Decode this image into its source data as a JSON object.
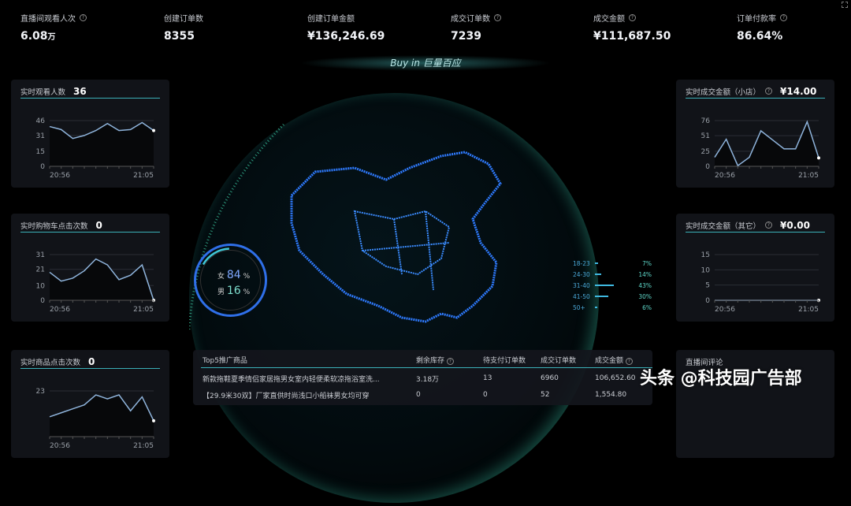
{
  "kpis": [
    {
      "label": "直播间观看人次",
      "help": true,
      "value": "6.08",
      "unit": "万"
    },
    {
      "label": "创建订单数",
      "help": false,
      "value": "8355",
      "unit": ""
    },
    {
      "label": "创建订单金额",
      "help": false,
      "value": "¥136,246.69",
      "unit": ""
    },
    {
      "label": "成交订单数",
      "help": true,
      "value": "7239",
      "unit": ""
    },
    {
      "label": "成交金额",
      "help": true,
      "value": "¥111,687.50",
      "unit": ""
    },
    {
      "label": "订单付款率",
      "help": true,
      "value": "86.64%",
      "unit": ""
    }
  ],
  "banner": "Buy in 巨量百应",
  "chart_data": [
    {
      "type": "line",
      "title": "实时观看人数",
      "current": "36",
      "x_ticks": [
        "20:56",
        "21:05"
      ],
      "y_ticks": [
        0,
        15,
        31,
        46
      ],
      "ylim": [
        0,
        46
      ],
      "values": [
        40,
        37,
        28,
        31,
        36,
        43,
        36,
        37,
        44,
        36
      ]
    },
    {
      "type": "line",
      "title": "实时购物车点击次数",
      "current": "0",
      "x_ticks": [
        "20:56",
        "21:05"
      ],
      "y_ticks": [
        0,
        10,
        21,
        31
      ],
      "ylim": [
        0,
        31
      ],
      "values": [
        19,
        13,
        15,
        20,
        28,
        24,
        14,
        17,
        24,
        0
      ]
    },
    {
      "type": "line",
      "title": "实时商品点击次数",
      "current": "0",
      "x_ticks": [
        "20:56",
        "21:05"
      ],
      "y_ticks": [
        23
      ],
      "ylim": [
        0,
        23
      ],
      "values": [
        10,
        12,
        14,
        16,
        21,
        19,
        21,
        13,
        20,
        8
      ]
    },
    {
      "type": "line",
      "title": "实时成交金额（小店）",
      "help": true,
      "current": "¥14.00",
      "x_ticks": [
        "20:56",
        "21:05"
      ],
      "y_ticks": [
        0,
        25,
        51,
        76
      ],
      "ylim": [
        0,
        76
      ],
      "values": [
        15,
        45,
        1,
        15,
        59,
        44,
        29,
        29,
        74,
        14
      ]
    },
    {
      "type": "line",
      "title": "实时成交金额（其它）",
      "help": true,
      "current": "¥0.00",
      "x_ticks": [
        "20:56",
        "21:05"
      ],
      "y_ticks": [
        0,
        5,
        10,
        15
      ],
      "ylim": [
        0,
        15
      ],
      "values": [
        0,
        0,
        0,
        0,
        0,
        0,
        0,
        0,
        0,
        0
      ]
    }
  ],
  "comments": {
    "title": "直播间评论"
  },
  "gender": {
    "female_label": "女",
    "female": "84",
    "male_label": "男",
    "male": "16",
    "unit": "%",
    "female_pct": 84
  },
  "age": [
    {
      "range": "18-23",
      "pct": "7%",
      "v": 7
    },
    {
      "range": "24-30",
      "pct": "14%",
      "v": 14
    },
    {
      "range": "31-40",
      "pct": "43%",
      "v": 43
    },
    {
      "range": "41-50",
      "pct": "30%",
      "v": 30
    },
    {
      "range": "50+",
      "pct": "6%",
      "v": 6
    }
  ],
  "top5": {
    "headers": [
      "Top5推广商品",
      "剩余库存",
      "待支付订单数",
      "成交订单数",
      "成交金额"
    ],
    "rows": [
      [
        "新款拖鞋夏季情侣家居拖男女室内轻便柔软凉拖浴室洗...",
        "3.18万",
        "13",
        "6960",
        "106,652.60"
      ],
      [
        "【29.9米30双】厂家直供时尚浅口小船袜男女均可穿",
        "0",
        "0",
        "52",
        "1,554.80"
      ]
    ]
  },
  "watermark": "头条 @科技园广告部",
  "colors": {
    "accent": "#3bb0b8",
    "line": "#8fb4dc",
    "map": "#2f7bff"
  }
}
